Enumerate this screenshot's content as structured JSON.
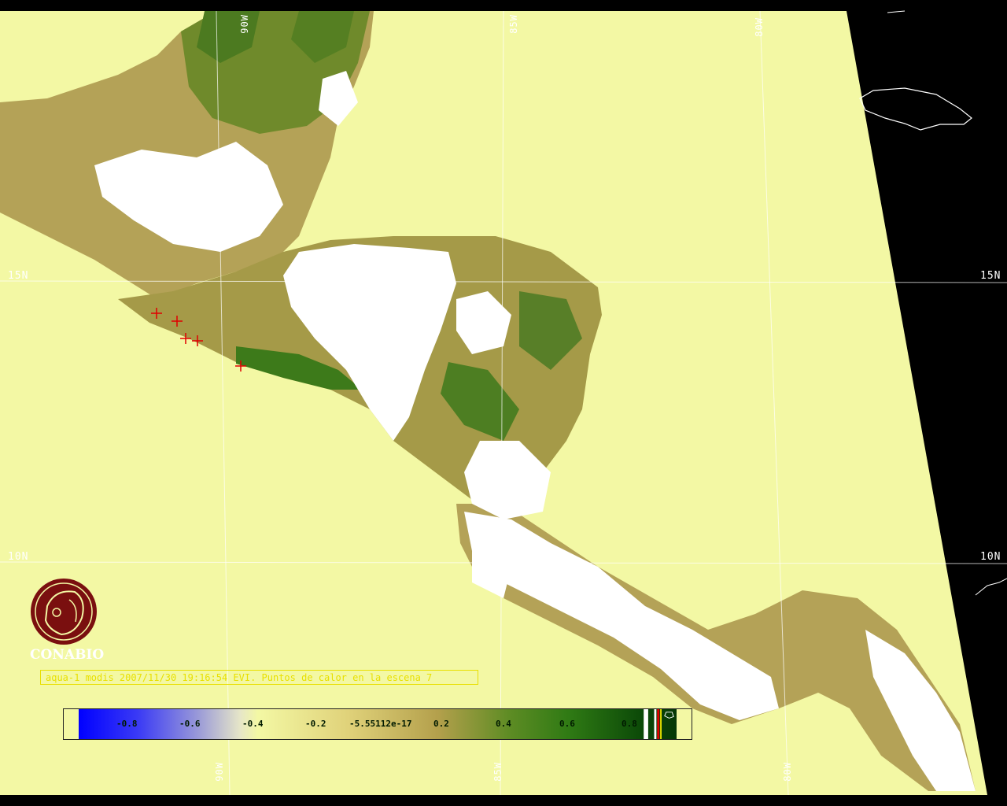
{
  "map": {
    "caption": "aqua-1 modis 2007/11/30 19:16:54 EVI. Puntos de calor en la escena 7",
    "logo_text": "CONABIO",
    "lat_labels": [
      "15N",
      "15N",
      "10N",
      "10N"
    ],
    "lon_labels": [
      "90W",
      "85W",
      "80W",
      "90W",
      "85W",
      "80W"
    ],
    "colorbar_ticks": [
      "-0.8",
      "-0.6",
      "-0.4",
      "-0.2",
      "-5.55112e-17",
      "0.2",
      "0.4",
      "0.6",
      "0.8"
    ],
    "colors": {
      "ocean": "#f3f8a4",
      "background": "#000000",
      "cloud": "#ffffff",
      "fire_marker": "#e00000",
      "caption": "#e8e000",
      "logo": "#7a0f0f"
    }
  }
}
